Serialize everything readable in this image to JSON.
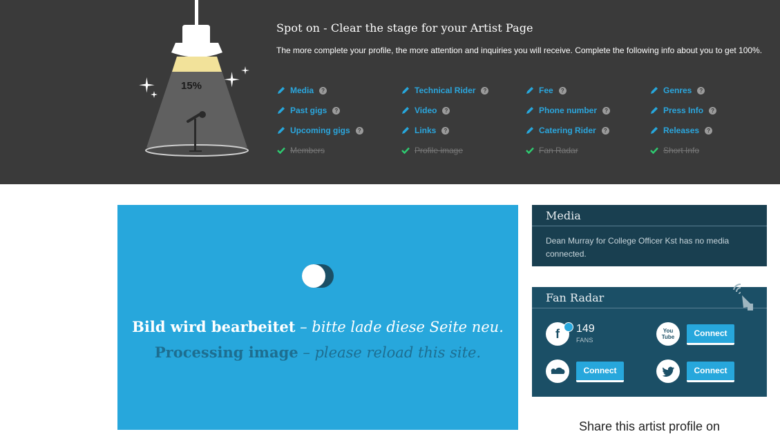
{
  "banner": {
    "title": "Spot on - Clear the stage for your Artist Page",
    "description": "The more complete your profile, the more attention and inquiries you will receive. Complete the following info about you to get 100%.",
    "percent": "15%",
    "progress_value": 0.15,
    "items": [
      {
        "label": "Media",
        "status": "todo"
      },
      {
        "label": "Past gigs",
        "status": "todo"
      },
      {
        "label": "Upcoming gigs",
        "status": "todo"
      },
      {
        "label": "Members",
        "status": "done"
      },
      {
        "label": "Technical Rider",
        "status": "todo"
      },
      {
        "label": "Video",
        "status": "todo"
      },
      {
        "label": "Links",
        "status": "todo"
      },
      {
        "label": "Profile image",
        "status": "done"
      },
      {
        "label": "Fee",
        "status": "todo"
      },
      {
        "label": "Phone number",
        "status": "todo"
      },
      {
        "label": "Catering Rider",
        "status": "todo"
      },
      {
        "label": "Fan Radar",
        "status": "done"
      },
      {
        "label": "Genres",
        "status": "todo"
      },
      {
        "label": "Press Info",
        "status": "todo"
      },
      {
        "label": "Releases",
        "status": "todo"
      },
      {
        "label": "Short Info",
        "status": "done"
      }
    ],
    "help_glyph": "?"
  },
  "processing": {
    "de_bold": "Bild wird bearbeitet",
    "de_italic": " – bitte lade diese Seite neu.",
    "en_bold": "Processing image",
    "en_italic": " – please reload this site."
  },
  "media_card": {
    "title": "Media",
    "text": "Dean Murray for College Officer Kst has no media connected."
  },
  "fan_radar": {
    "title": "Fan Radar",
    "facebook_fans": "149",
    "fans_label": "FANS",
    "connect_label": "Connect"
  },
  "share": {
    "text": "Share this artist profile on"
  },
  "colors": {
    "accent": "#27a7dc",
    "banner_bg": "#3a3a3a",
    "card_bg": "#1b4f66",
    "done": "#2ecc71"
  },
  "icons": [
    "pencil-icon",
    "check-icon",
    "help-icon",
    "facebook-icon",
    "youtube-icon",
    "soundcloud-icon",
    "twitter-icon",
    "radar-dish-icon",
    "spotlight-lamp-icon",
    "microphone-icon"
  ]
}
